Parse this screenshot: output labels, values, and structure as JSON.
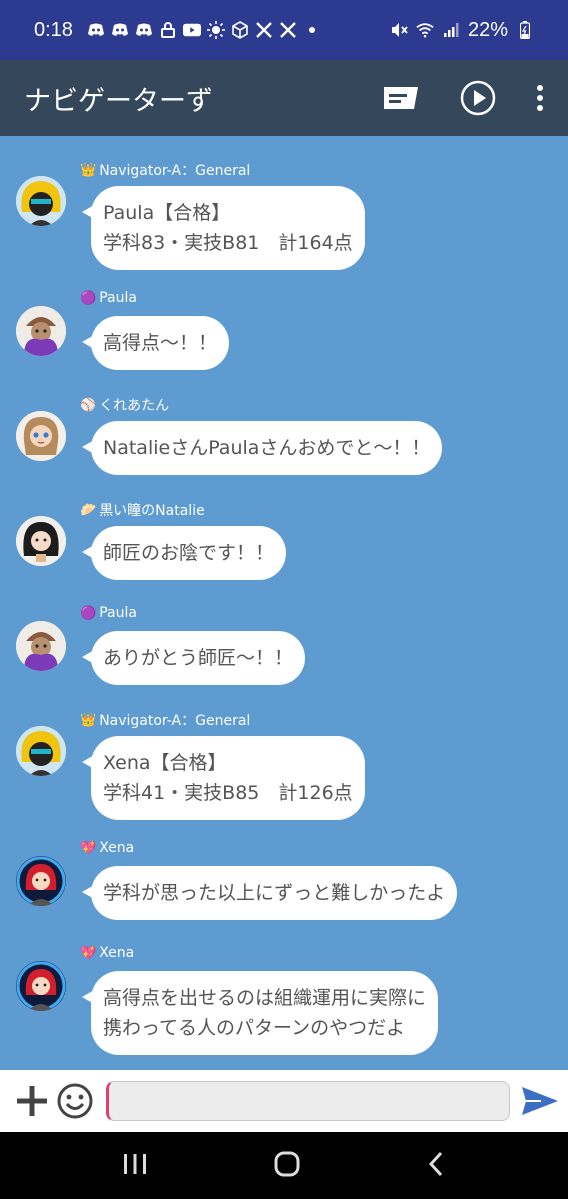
{
  "status_bar": {
    "time": "0:18",
    "battery": "22%",
    "left_icons": [
      "discord-icon",
      "discord-icon",
      "discord-icon",
      "lock-icon",
      "youtube-icon",
      "brightness-icon",
      "cube-icon",
      "x-icon",
      "x-icon",
      "dot-icon"
    ],
    "right_icons": [
      "mute-icon",
      "wifi-icon",
      "signal-icon",
      "battery-charging-icon"
    ]
  },
  "app_bar": {
    "title": "ナビゲーターず"
  },
  "messages": [
    {
      "badge": "👑",
      "sender": "Navigator-A：General",
      "lines": [
        "Paula【合格】",
        "学科83・実技B81　計164点"
      ]
    },
    {
      "badge": "🟣",
      "sender": "Paula",
      "lines": [
        "高得点〜！！"
      ]
    },
    {
      "badge": "⚾",
      "sender": "くれあたん",
      "lines": [
        "NatalieさんPaulaさんおめでと〜！！"
      ]
    },
    {
      "badge": "🥟",
      "sender": "黒い瞳のNatalie",
      "lines": [
        "師匠のお陰です！！"
      ]
    },
    {
      "badge": "🟣",
      "sender": "Paula",
      "lines": [
        "ありがとう師匠〜！！"
      ]
    },
    {
      "badge": "👑",
      "sender": "Navigator-A：General",
      "lines": [
        "Xena【合格】",
        "学科41・実技B85　計126点"
      ]
    },
    {
      "badge": "💖",
      "sender": "Xena",
      "lines": [
        "学科が思った以上にずっと難しかったよ"
      ]
    },
    {
      "badge": "💖",
      "sender": "Xena",
      "lines": [
        "高得点を出せるのは組織運用に実際に",
        "携わってる人のパターンのやつだよ"
      ]
    }
  ],
  "input": {
    "value": "",
    "placeholder": ""
  },
  "colors": {
    "status_bar": "#2c3a8f",
    "app_bar": "#35475b",
    "chat_background": "#5e9bd1",
    "send_accent": "#3b6fc4"
  }
}
